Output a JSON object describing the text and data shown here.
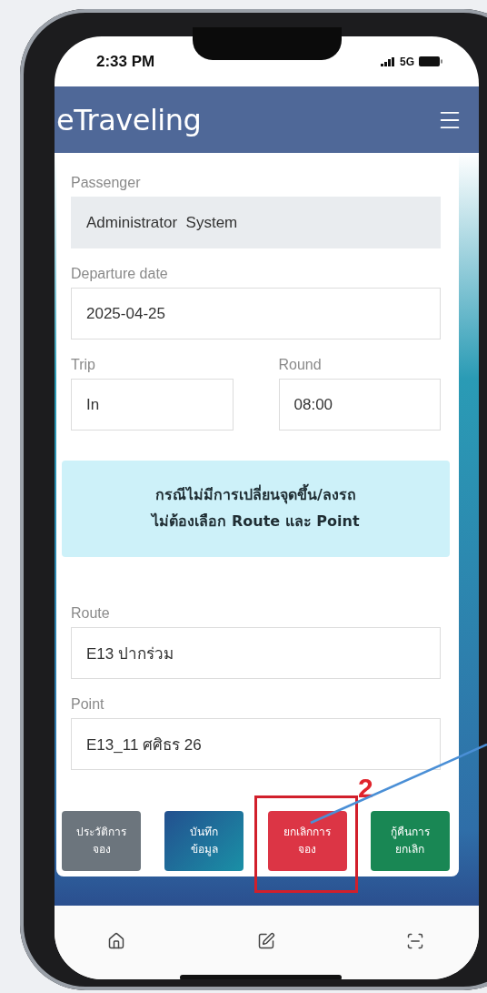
{
  "status_bar": {
    "time": "2:33 PM",
    "network": "5G"
  },
  "header": {
    "title": "eTraveling"
  },
  "form_top": [
    [
      {
        "label": "Passenger",
        "value": "Administrator  System",
        "kind": "readonly"
      }
    ],
    [
      {
        "label": "Departure date",
        "value": "2025-04-25",
        "kind": "input"
      }
    ],
    [
      {
        "label": "Trip",
        "value": "In",
        "kind": "input"
      },
      {
        "label": "Round",
        "value": "08:00",
        "kind": "input"
      }
    ]
  ],
  "notice": {
    "text": "กรณีไม่มีการเปลี่ยนจุดขึ้น/ลงรถ\nไม่ต้องเลือก Route และ Point"
  },
  "form_bottom": [
    [
      {
        "label": "Route",
        "value": "E13 ปากร่วม",
        "kind": "input"
      }
    ],
    [
      {
        "label": "Point",
        "value": "E13_11 ศศิธร 26",
        "kind": "input"
      }
    ]
  ],
  "buttons": [
    {
      "label": "ประวัติการ\nจอง",
      "kind": "secondary",
      "highlighted": false
    },
    {
      "label": "บันทึก\nข้อมูล",
      "kind": "primary",
      "highlighted": false
    },
    {
      "label": "ยกเลิกการ\nจอง",
      "kind": "danger",
      "highlighted": true
    },
    {
      "label": "กู้คืนการ\nยกเลิก",
      "kind": "success",
      "highlighted": false
    }
  ],
  "annotation": {
    "marker": "2"
  }
}
